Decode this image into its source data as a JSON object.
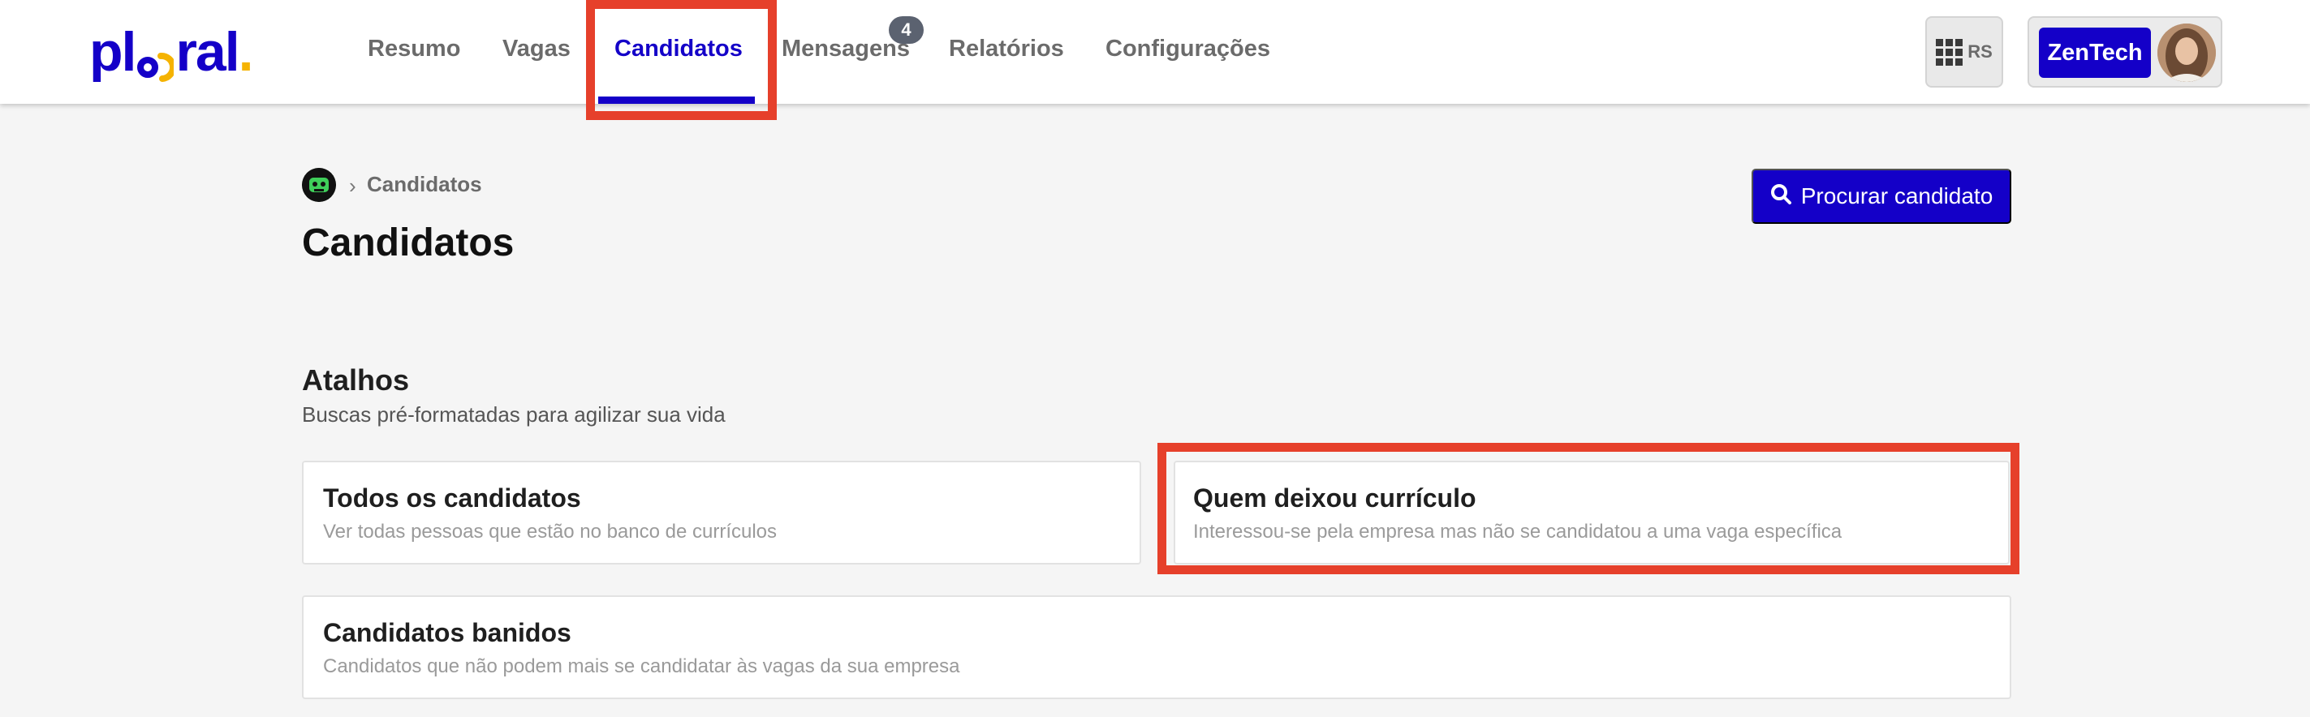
{
  "brand": {
    "logo_text_a": "pl",
    "logo_text_b": "ral",
    "logo_dot": ".",
    "primary_color": "#1400c8",
    "accent_color": "#f5b301",
    "highlight_color": "#e6402b"
  },
  "nav": {
    "items": [
      {
        "label": "Resumo"
      },
      {
        "label": "Vagas"
      },
      {
        "label": "Candidatos"
      },
      {
        "label": "Mensagens",
        "badge": "4"
      },
      {
        "label": "Relatórios"
      },
      {
        "label": "Configurações"
      }
    ],
    "active": "Candidatos"
  },
  "header_right": {
    "apps_label": "RS",
    "company_button": "ZenTech"
  },
  "breadcrumb": {
    "current": "Candidatos",
    "separator": "›"
  },
  "page": {
    "title": "Candidatos",
    "search_button": "Procurar candidato"
  },
  "shortcuts": {
    "title": "Atalhos",
    "subtitle": "Buscas pré-formatadas para agilizar sua vida",
    "cards": [
      {
        "title": "Todos os candidatos",
        "description": "Ver todas pessoas que estão no banco de currículos"
      },
      {
        "title": "Quem deixou currículo",
        "description": "Interessou-se pela empresa mas não se candidatou a uma vaga específica"
      },
      {
        "title": "Candidatos banidos",
        "description": "Candidatos que não podem mais se candidatar às vagas da sua empresa"
      }
    ]
  }
}
